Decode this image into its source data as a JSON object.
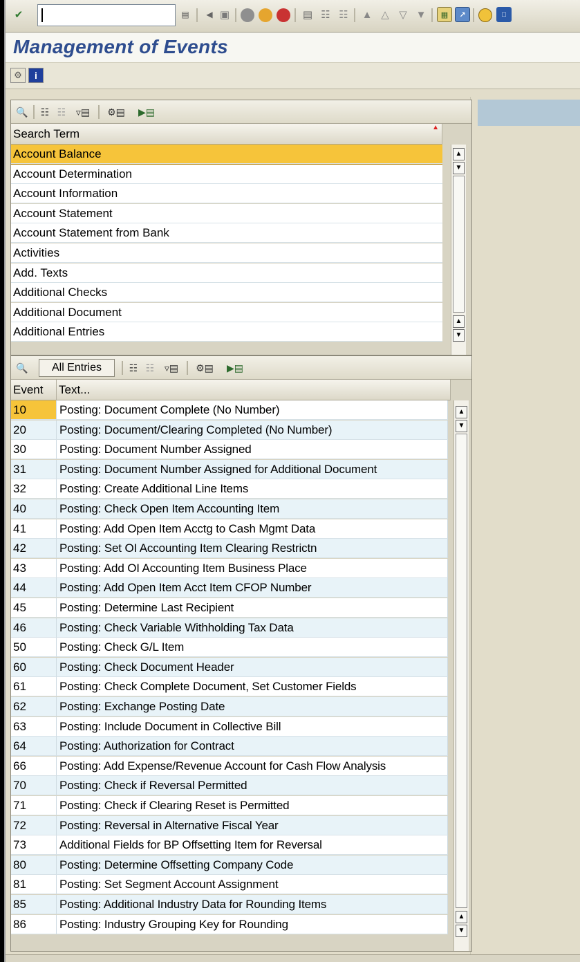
{
  "window": {
    "title": "Management of Events"
  },
  "system_toolbar": {
    "command_field_value": ""
  },
  "search_terms_grid": {
    "column_header": "Search Term",
    "rows": [
      "Account Balance",
      "Account Determination",
      "Account Information",
      "Account Statement",
      "Account Statement from Bank",
      "Activities",
      "Add. Texts",
      "Additional Checks",
      "Additional Document",
      "Additional Entries"
    ],
    "selected_index": 0
  },
  "events_grid": {
    "toolbar": {
      "all_entries_label": "All Entries"
    },
    "columns": [
      "Event",
      "Text..."
    ],
    "rows": [
      {
        "event": "10",
        "text": "Posting: Document Complete (No Number)"
      },
      {
        "event": "20",
        "text": "Posting: Document/Clearing Completed (No Number)"
      },
      {
        "event": "30",
        "text": "Posting: Document Number Assigned"
      },
      {
        "event": "31",
        "text": "Posting: Document Number Assigned for Additional Document"
      },
      {
        "event": "32",
        "text": "Posting: Create Additional Line Items"
      },
      {
        "event": "40",
        "text": "Posting: Check Open Item Accounting Item"
      },
      {
        "event": "41",
        "text": "Posting: Add Open Item Acctg to Cash Mgmt Data"
      },
      {
        "event": "42",
        "text": "Posting: Set OI Accounting Item Clearing Restrictn"
      },
      {
        "event": "43",
        "text": "Posting: Add OI Accounting Item Business Place"
      },
      {
        "event": "44",
        "text": "Posting: Add Open Item Acct Item CFOP Number"
      },
      {
        "event": "45",
        "text": "Posting: Determine Last Recipient"
      },
      {
        "event": "46",
        "text": "Posting: Check Variable Withholding Tax Data"
      },
      {
        "event": "50",
        "text": "Posting: Check G/L Item"
      },
      {
        "event": "60",
        "text": "Posting: Check Document Header"
      },
      {
        "event": "61",
        "text": "Posting: Check Complete Document, Set Customer Fields"
      },
      {
        "event": "62",
        "text": "Posting: Exchange Posting Date"
      },
      {
        "event": "63",
        "text": "Posting: Include Document in Collective Bill"
      },
      {
        "event": "64",
        "text": "Posting: Authorization for Contract"
      },
      {
        "event": "66",
        "text": "Posting: Add Expense/Revenue Account for Cash Flow Analysis"
      },
      {
        "event": "70",
        "text": "Posting: Check if Reversal Permitted"
      },
      {
        "event": "71",
        "text": "Posting: Check if Clearing Reset is Permitted"
      },
      {
        "event": "72",
        "text": "Posting: Reversal in Alternative Fiscal Year"
      },
      {
        "event": "73",
        "text": "Additional Fields for BP Offsetting Item for Reversal"
      },
      {
        "event": "80",
        "text": "Posting: Determine Offsetting Company Code"
      },
      {
        "event": "81",
        "text": "Posting: Set Segment Account Assignment"
      },
      {
        "event": "85",
        "text": "Posting: Additional Industry Data for Rounding Items"
      },
      {
        "event": "86",
        "text": "Posting: Industry Grouping Key for Rounding"
      }
    ],
    "selected_index": 0
  },
  "colors": {
    "selected_row": "#f6c43a",
    "row_light": "#ffffff",
    "row_alt": "#e8f3f8",
    "title_text": "#2e4d8f",
    "right_band": "#b3c8d6"
  }
}
